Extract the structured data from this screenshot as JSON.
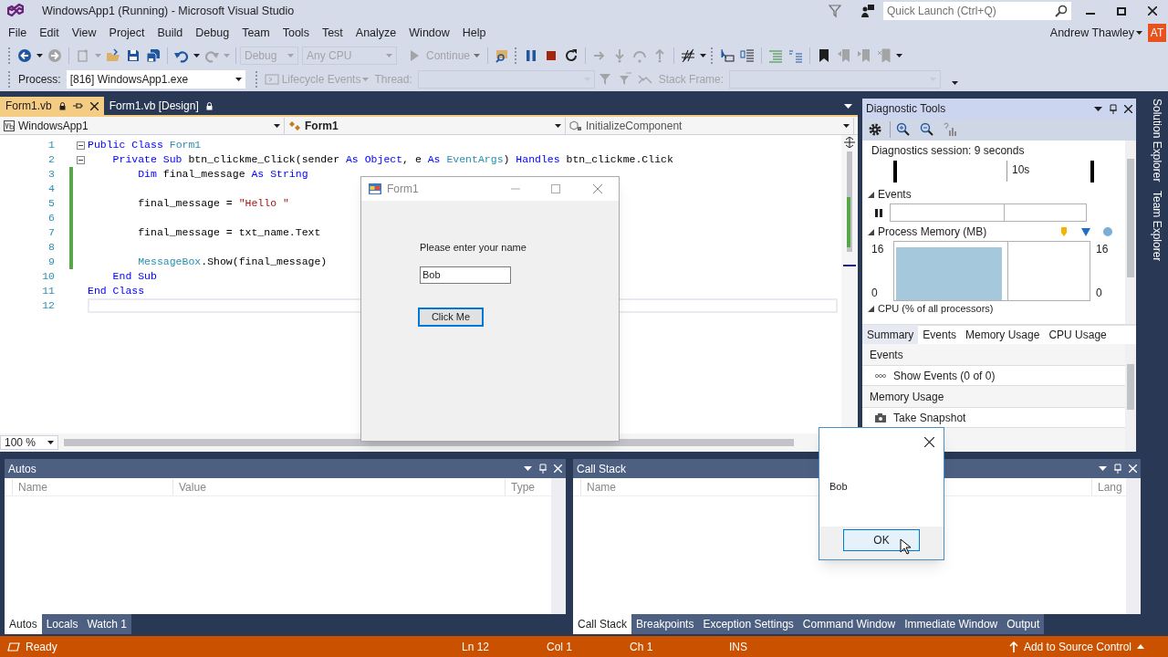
{
  "window": {
    "title": "WindowsApp1 (Running) - Microsoft Visual Studio"
  },
  "quick_launch": {
    "placeholder": "Quick Launch (Ctrl+Q)"
  },
  "menu": [
    "File",
    "Edit",
    "View",
    "Project",
    "Build",
    "Debug",
    "Team",
    "Tools",
    "Test",
    "Analyze",
    "Window",
    "Help"
  ],
  "user": {
    "name": "Andrew Thawley",
    "initials": "AT"
  },
  "toolbar": {
    "configuration": {
      "value": "Debug",
      "disabled": true
    },
    "platform": {
      "value": "Any CPU",
      "disabled": true
    },
    "continue": {
      "label": "Continue",
      "disabled": true
    }
  },
  "debug_location": {
    "process_label": "Process:",
    "process": "[816] WindowsApp1.exe",
    "lifecycle": "Lifecycle Events",
    "thread_label": "Thread:",
    "stack_frame_label": "Stack Frame:"
  },
  "editor": {
    "tabs": [
      {
        "label": "Form1.vb",
        "selected": true
      },
      {
        "label": "Form1.vb [Design]",
        "selected": false
      }
    ],
    "nav": [
      "WindowsApp1",
      "Form1",
      "InitializeComponent"
    ],
    "lines": [
      {
        "number": "1",
        "changed": false,
        "collapsible": true,
        "current": false,
        "tokens": [
          {
            "text": "Public Class",
            "kind": "keyword"
          },
          {
            "text": " Form1",
            "kind": "type"
          }
        ]
      },
      {
        "number": "2",
        "changed": false,
        "collapsible": true,
        "current": false,
        "tokens": [
          {
            "text": "    Private Sub",
            "kind": "keyword"
          },
          {
            "text": " btn_clickme_Click(sender ",
            "kind": "plain"
          },
          {
            "text": "As Object",
            "kind": "keyword"
          },
          {
            "text": ", e ",
            "kind": "plain"
          },
          {
            "text": "As",
            "kind": "keyword"
          },
          {
            "text": " EventArgs",
            "kind": "type"
          },
          {
            "text": ") ",
            "kind": "plain"
          },
          {
            "text": "Handles",
            "kind": "keyword"
          },
          {
            "text": " btn_clickme.Click",
            "kind": "plain"
          }
        ]
      },
      {
        "number": "3",
        "changed": true,
        "collapsible": false,
        "current": false,
        "tokens": [
          {
            "text": "        Dim",
            "kind": "keyword"
          },
          {
            "text": " final_message ",
            "kind": "plain"
          },
          {
            "text": "As String",
            "kind": "keyword"
          }
        ]
      },
      {
        "number": "4",
        "changed": true,
        "collapsible": false,
        "current": false
      },
      {
        "number": "5",
        "changed": true,
        "collapsible": false,
        "current": false,
        "tokens": [
          {
            "text": "        final_message = ",
            "kind": "plain"
          },
          {
            "text": "\"Hello \"",
            "kind": "string"
          }
        ]
      },
      {
        "number": "6",
        "changed": true,
        "collapsible": false,
        "current": false
      },
      {
        "number": "7",
        "changed": true,
        "collapsible": false,
        "current": false,
        "tokens": [
          {
            "text": "        final_message = txt_name.Text",
            "kind": "plain"
          }
        ]
      },
      {
        "number": "8",
        "changed": true,
        "collapsible": false,
        "current": false
      },
      {
        "number": "9",
        "changed": true,
        "collapsible": false,
        "current": false,
        "tokens": [
          {
            "text": "        MessageBox",
            "kind": "type"
          },
          {
            "text": ".Show(final_message)",
            "kind": "plain"
          }
        ]
      },
      {
        "number": "10",
        "changed": false,
        "collapsible": false,
        "current": false,
        "tokens": [
          {
            "text": "    End Sub",
            "kind": "keyword"
          }
        ]
      },
      {
        "number": "11",
        "changed": false,
        "collapsible": false,
        "current": false,
        "tokens": [
          {
            "text": "End Class",
            "kind": "keyword"
          }
        ]
      },
      {
        "number": "12",
        "changed": false,
        "collapsible": false,
        "current": true
      }
    ],
    "zoom": "100 %"
  },
  "form_window": {
    "title": "Form1",
    "prompt": "Please enter your name",
    "name_value": "Bob",
    "button": "Click Me"
  },
  "message_box": {
    "text": "Bob",
    "button": "OK"
  },
  "diagnostic_tools": {
    "title": "Diagnostic Tools",
    "session": "Diagnostics session: 9 seconds",
    "ruler_label": "10s",
    "events_header": "Events",
    "memory_header": "Process Memory (MB)",
    "memory_axis_left": {
      "max": "16",
      "min": "0"
    },
    "memory_axis_right": {
      "max": "16",
      "min": "0"
    },
    "cpu_header": "CPU (% of all processors)",
    "tabs": [
      {
        "label": "Summary",
        "selected": true
      },
      {
        "label": "Events",
        "selected": false
      },
      {
        "label": "Memory Usage",
        "selected": false
      },
      {
        "label": "CPU Usage",
        "selected": false
      }
    ],
    "sections": [
      {
        "title": "Events",
        "action": "Show Events (0 of 0)",
        "kind": "events"
      },
      {
        "title": "Memory Usage",
        "action": "Take Snapshot",
        "kind": "snapshot"
      }
    ]
  },
  "side_tabs": [
    "Solution Explorer",
    "Team Explorer"
  ],
  "autos": {
    "title": "Autos",
    "columns": [
      "Name",
      "Value",
      "Type"
    ],
    "tabs": [
      {
        "label": "Autos",
        "selected": true
      },
      {
        "label": "Locals",
        "selected": false
      },
      {
        "label": "Watch 1",
        "selected": false
      }
    ]
  },
  "call_stack": {
    "title": "Call Stack",
    "columns": [
      "Name",
      "Lang"
    ],
    "tabs": [
      {
        "label": "Call Stack",
        "selected": true
      },
      {
        "label": "Breakpoints",
        "selected": false
      },
      {
        "label": "Exception Settings",
        "selected": false
      },
      {
        "label": "Command Window",
        "selected": false
      },
      {
        "label": "Immediate Window",
        "selected": false
      },
      {
        "label": "Output",
        "selected": false
      }
    ]
  },
  "status_bar": {
    "state": "Ready",
    "line": "Ln 12",
    "column": "Col 1",
    "char": "Ch 1",
    "mode": "INS",
    "source_control": "Add to Source Control"
  }
}
